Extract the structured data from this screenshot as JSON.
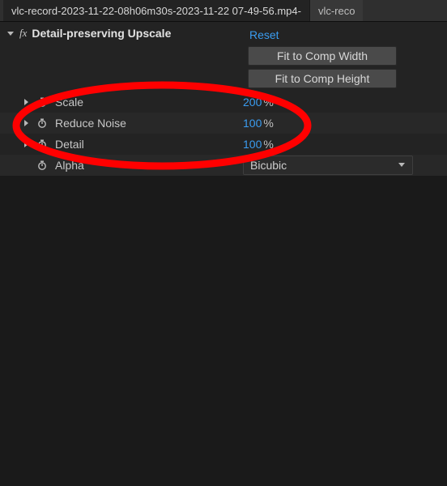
{
  "tabs": {
    "active": "vlc-record-2023-11-22-08h06m30s-2023-11-22 07-49-56.mp4-",
    "inactive": "vlc-reco"
  },
  "effect": {
    "fx_badge": "fx",
    "name": "Detail-preserving Upscale",
    "reset": "Reset",
    "fit_width": "Fit to Comp Width",
    "fit_height": "Fit to Comp Height"
  },
  "props": {
    "scale": {
      "label": "Scale",
      "value": "200",
      "unit": "%"
    },
    "reduce_noise": {
      "label": "Reduce Noise",
      "value": "100",
      "unit": "%"
    },
    "detail": {
      "label": "Detail",
      "value": "100",
      "unit": "%"
    },
    "alpha": {
      "label": "Alpha",
      "value": "Bicubic"
    }
  }
}
